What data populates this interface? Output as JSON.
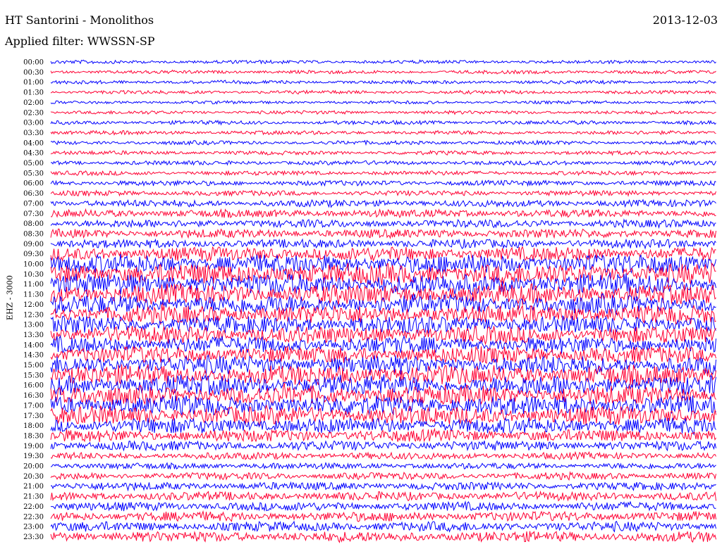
{
  "header": {
    "title": "HT Santorini - Monolithos",
    "date": "2013-12-03",
    "filter": "Applied filter: WWSSN-SP"
  },
  "chart_data": {
    "type": "line",
    "title": "HT Santorini - Monolithos",
    "ylabel": "EHZ - 3000",
    "colors": [
      "#0000ff",
      "#ff0033"
    ],
    "grid": false,
    "rows": [
      {
        "label": "00:00",
        "amplitude": 0.4
      },
      {
        "label": "00:30",
        "amplitude": 0.4
      },
      {
        "label": "01:00",
        "amplitude": 0.4
      },
      {
        "label": "01:30",
        "amplitude": 0.4
      },
      {
        "label": "02:00",
        "amplitude": 0.35
      },
      {
        "label": "02:30",
        "amplitude": 0.4
      },
      {
        "label": "03:00",
        "amplitude": 0.45
      },
      {
        "label": "03:30",
        "amplitude": 0.45
      },
      {
        "label": "04:00",
        "amplitude": 0.45
      },
      {
        "label": "04:30",
        "amplitude": 0.45
      },
      {
        "label": "05:00",
        "amplitude": 0.5
      },
      {
        "label": "05:30",
        "amplitude": 0.5
      },
      {
        "label": "06:00",
        "amplitude": 0.6
      },
      {
        "label": "06:30",
        "amplitude": 0.6
      },
      {
        "label": "07:00",
        "amplitude": 0.8
      },
      {
        "label": "07:30",
        "amplitude": 0.9
      },
      {
        "label": "08:00",
        "amplitude": 0.9
      },
      {
        "label": "08:30",
        "amplitude": 1.0
      },
      {
        "label": "09:00",
        "amplitude": 1.0
      },
      {
        "label": "09:30",
        "amplitude": 1.6
      },
      {
        "label": "10:00",
        "amplitude": 2.2
      },
      {
        "label": "10:30",
        "amplitude": 2.4
      },
      {
        "label": "11:00",
        "amplitude": 2.4
      },
      {
        "label": "11:30",
        "amplitude": 2.3
      },
      {
        "label": "12:00",
        "amplitude": 2.2
      },
      {
        "label": "12:30",
        "amplitude": 2.1
      },
      {
        "label": "13:00",
        "amplitude": 2.0
      },
      {
        "label": "13:30",
        "amplitude": 2.0
      },
      {
        "label": "14:00",
        "amplitude": 1.9
      },
      {
        "label": "14:30",
        "amplitude": 1.9
      },
      {
        "label": "15:00",
        "amplitude": 2.1
      },
      {
        "label": "15:30",
        "amplitude": 2.3
      },
      {
        "label": "16:00",
        "amplitude": 2.3
      },
      {
        "label": "16:30",
        "amplitude": 2.2
      },
      {
        "label": "17:00",
        "amplitude": 2.2
      },
      {
        "label": "17:30",
        "amplitude": 2.1
      },
      {
        "label": "18:00",
        "amplitude": 1.8
      },
      {
        "label": "18:30",
        "amplitude": 1.4
      },
      {
        "label": "19:00",
        "amplitude": 1.1
      },
      {
        "label": "19:30",
        "amplitude": 0.8
      },
      {
        "label": "20:00",
        "amplitude": 0.7
      },
      {
        "label": "20:30",
        "amplitude": 0.8
      },
      {
        "label": "21:00",
        "amplitude": 0.9
      },
      {
        "label": "21:30",
        "amplitude": 1.0
      },
      {
        "label": "22:00",
        "amplitude": 1.0
      },
      {
        "label": "22:30",
        "amplitude": 1.1
      },
      {
        "label": "23:00",
        "amplitude": 1.1
      },
      {
        "label": "23:30",
        "amplitude": 1.2
      }
    ]
  }
}
